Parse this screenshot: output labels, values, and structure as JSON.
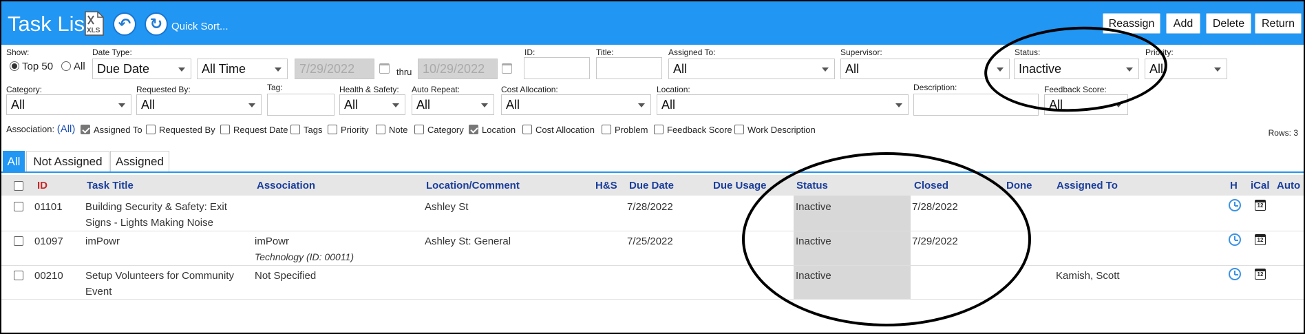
{
  "header": {
    "title": "Task List",
    "quick_sort": "Quick Sort...",
    "buttons": {
      "reassign": "Reassign",
      "add": "Add",
      "delete": "Delete",
      "return": "Return"
    },
    "icons": {
      "export": "xls-icon",
      "back": "undo-icon",
      "sort": "refresh-icon"
    }
  },
  "filters": {
    "show": {
      "label": "Show:",
      "top50": "Top 50",
      "all": "All",
      "selected": "Top 50"
    },
    "date_type": {
      "label": "Date Type:",
      "value": "Due Date"
    },
    "date_range": {
      "value": "All Time"
    },
    "date_from": "7/29/2022",
    "thru": "thru",
    "date_to": "10/29/2022",
    "id": {
      "label": "ID:",
      "value": ""
    },
    "title": {
      "label": "Title:",
      "value": ""
    },
    "assigned_to": {
      "label": "Assigned To:",
      "value": "All"
    },
    "supervisor": {
      "label": "Supervisor:",
      "value": "All"
    },
    "status": {
      "label": "Status:",
      "value": "Inactive"
    },
    "priority": {
      "label": "Priority:",
      "value": "All"
    },
    "category": {
      "label": "Category:",
      "value": "All"
    },
    "requested_by": {
      "label": "Requested By:",
      "value": "All"
    },
    "tag": {
      "label": "Tag:",
      "value": ""
    },
    "health_safety": {
      "label": "Health & Safety:",
      "value": "All"
    },
    "auto_repeat": {
      "label": "Auto Repeat:",
      "value": "All"
    },
    "cost_allocation": {
      "label": "Cost Allocation:",
      "value": "All"
    },
    "location": {
      "label": "Location:",
      "value": "All"
    },
    "description": {
      "label": "Description:",
      "value": ""
    },
    "feedback_score": {
      "label": "Feedback Score:",
      "value": "All"
    }
  },
  "association": {
    "label": "Association:",
    "all_link": "(All)",
    "options": [
      {
        "label": "Assigned To",
        "checked": true
      },
      {
        "label": "Requested By",
        "checked": false
      },
      {
        "label": "Request Date",
        "checked": false
      },
      {
        "label": "Tags",
        "checked": false
      },
      {
        "label": "Priority",
        "checked": false
      },
      {
        "label": "Note",
        "checked": false
      },
      {
        "label": "Category",
        "checked": false
      },
      {
        "label": "Location",
        "checked": true
      },
      {
        "label": "Cost Allocation",
        "checked": false
      },
      {
        "label": "Problem",
        "checked": false
      },
      {
        "label": "Feedback Score",
        "checked": false
      },
      {
        "label": "Work Description",
        "checked": false
      }
    ],
    "rows_count": "Rows: 3"
  },
  "tabs": [
    {
      "label": "All",
      "active": true
    },
    {
      "label": "Not Assigned",
      "active": false
    },
    {
      "label": "Assigned",
      "active": false
    }
  ],
  "table": {
    "columns": [
      "ID",
      "Task Title",
      "Association",
      "Location/Comment",
      "H&S",
      "Due Date",
      "Due Usage",
      "Status",
      "Closed",
      "Done",
      "Assigned To",
      "H",
      "iCal",
      "Auto"
    ],
    "rows": [
      {
        "id": "01101",
        "title": "Building Security & Safety: Exit Signs - Lights Making Noise",
        "association": "",
        "association_sub": "",
        "location": "Ashley St",
        "due_date": "7/28/2022",
        "status": "Inactive",
        "closed": "7/28/2022",
        "assigned_to": ""
      },
      {
        "id": "01097",
        "title": "imPowr",
        "association": "imPowr",
        "association_sub": "Technology  (ID: 00011)",
        "location": "Ashley St: General",
        "due_date": "7/25/2022",
        "status": "Inactive",
        "closed": "7/29/2022",
        "assigned_to": ""
      },
      {
        "id": "00210",
        "title": "Setup Volunteers for Community Event",
        "association": "Not Specified",
        "association_sub": "",
        "location": "",
        "due_date": "",
        "status": "Inactive",
        "closed": "",
        "assigned_to": "Kamish, Scott"
      }
    ],
    "ical_day": "12"
  },
  "colors": {
    "header": "#2196f3",
    "id_header": "#c62828",
    "column_header": "#1b3e9c",
    "status_highlight": "#d8d8d8"
  }
}
